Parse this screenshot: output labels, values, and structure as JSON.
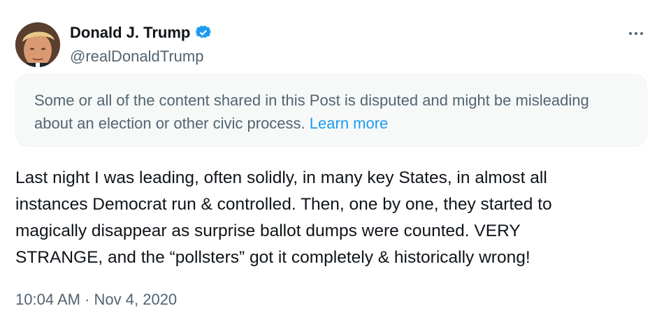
{
  "author": {
    "display_name": "Donald J. Trump",
    "handle": "@realDonaldTrump",
    "verified_icon": "verified-badge-icon"
  },
  "more_icon": "more-options-icon",
  "notice": {
    "text": "Some or all of the content shared in this Post is disputed and might be misleading about an election or other civic process.",
    "link_text": "Learn more"
  },
  "post": {
    "lines": [
      "Last night I was leading, often solidly, in many key States, in almost all",
      "instances Democrat run & controlled. Then, one by one, they started to",
      "magically disappear as surprise ballot dumps were counted. VERY",
      "STRANGE, and the “pollsters” got it completely & historically wrong!"
    ]
  },
  "meta": {
    "time": "10:04 AM",
    "separator": "·",
    "date": "Nov 4, 2020"
  },
  "colors": {
    "accent": "#1d9bf0",
    "text_primary": "#0f1419",
    "text_secondary": "#536471",
    "notice_bg": "#f7f9f9"
  }
}
